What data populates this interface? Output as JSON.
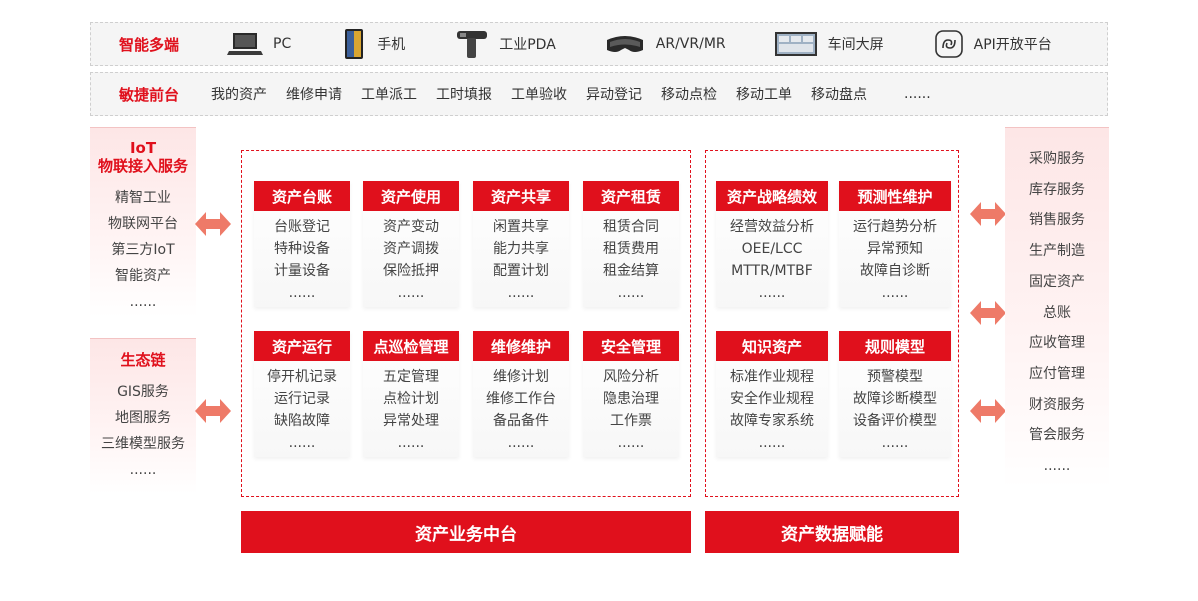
{
  "devices": {
    "title": "智能多端",
    "items": [
      {
        "label": "PC",
        "icon": "laptop-icon"
      },
      {
        "label": "手机",
        "icon": "phone-icon"
      },
      {
        "label": "工业PDA",
        "icon": "pda-scanner-icon"
      },
      {
        "label": "AR/VR/MR",
        "icon": "vr-headset-icon"
      },
      {
        "label": "车间大屏",
        "icon": "big-screen-icon"
      },
      {
        "label": "API开放平台",
        "icon": "api-link-icon"
      }
    ]
  },
  "frontend": {
    "title": "敏捷前台",
    "items": [
      "我的资产",
      "维修申请",
      "工单派工",
      "工时填报",
      "工单验收",
      "异动登记",
      "移动点检",
      "移动工单",
      "移动盘点",
      "......"
    ]
  },
  "iot": {
    "title_line1": "IoT",
    "title_line2": "物联接入服务",
    "items": [
      "精智工业",
      "物联网平台",
      "第三方IoT",
      "智能资产",
      "......"
    ]
  },
  "eco": {
    "title": "生态链",
    "items": [
      "GIS服务",
      "地图服务",
      "三维模型服务",
      "......"
    ]
  },
  "business_cards": [
    {
      "title": "资产台账",
      "lines": [
        "台账登记",
        "特种设备",
        "计量设备",
        "......"
      ]
    },
    {
      "title": "资产使用",
      "lines": [
        "资产变动",
        "资产调拨",
        "保险抵押",
        "......"
      ]
    },
    {
      "title": "资产共享",
      "lines": [
        "闲置共享",
        "能力共享",
        "配置计划",
        "......"
      ]
    },
    {
      "title": "资产租赁",
      "lines": [
        "租赁合同",
        "租赁费用",
        "租金结算",
        "......"
      ]
    },
    {
      "title": "资产运行",
      "lines": [
        "停开机记录",
        "运行记录",
        "缺陷故障",
        "......"
      ]
    },
    {
      "title": "点巡检管理",
      "lines": [
        "五定管理",
        "点检计划",
        "异常处理",
        "......"
      ]
    },
    {
      "title": "维修维护",
      "lines": [
        "维修计划",
        "维修工作台",
        "备品备件",
        "......"
      ]
    },
    {
      "title": "安全管理",
      "lines": [
        "风险分析",
        "隐患治理",
        "工作票",
        "......"
      ]
    }
  ],
  "data_cards": [
    {
      "title": "资产战略绩效",
      "lines": [
        "经营效益分析",
        "OEE/LCC",
        "MTTR/MTBF",
        "......"
      ]
    },
    {
      "title": "预测性维护",
      "lines": [
        "运行趋势分析",
        "异常预知",
        "故障自诊断",
        "......"
      ]
    },
    {
      "title": "知识资产",
      "lines": [
        "标准作业规程",
        "安全作业规程",
        "故障专家系统",
        "......"
      ]
    },
    {
      "title": "规则模型",
      "lines": [
        "预警模型",
        "故障诊断模型",
        "设备评价模型",
        "......"
      ]
    }
  ],
  "banners": {
    "business": "资产业务中台",
    "data": "资产数据赋能"
  },
  "services": [
    "采购服务",
    "库存服务",
    "销售服务",
    "生产制造",
    "固定资产",
    "总账",
    "应收管理",
    "应付管理",
    "财资服务",
    "管会服务",
    "......"
  ],
  "colors": {
    "accent": "#e0101c",
    "panel": "#f5f5f5",
    "side_bg": "#fde6e6",
    "arrow": "#ee7a68"
  }
}
